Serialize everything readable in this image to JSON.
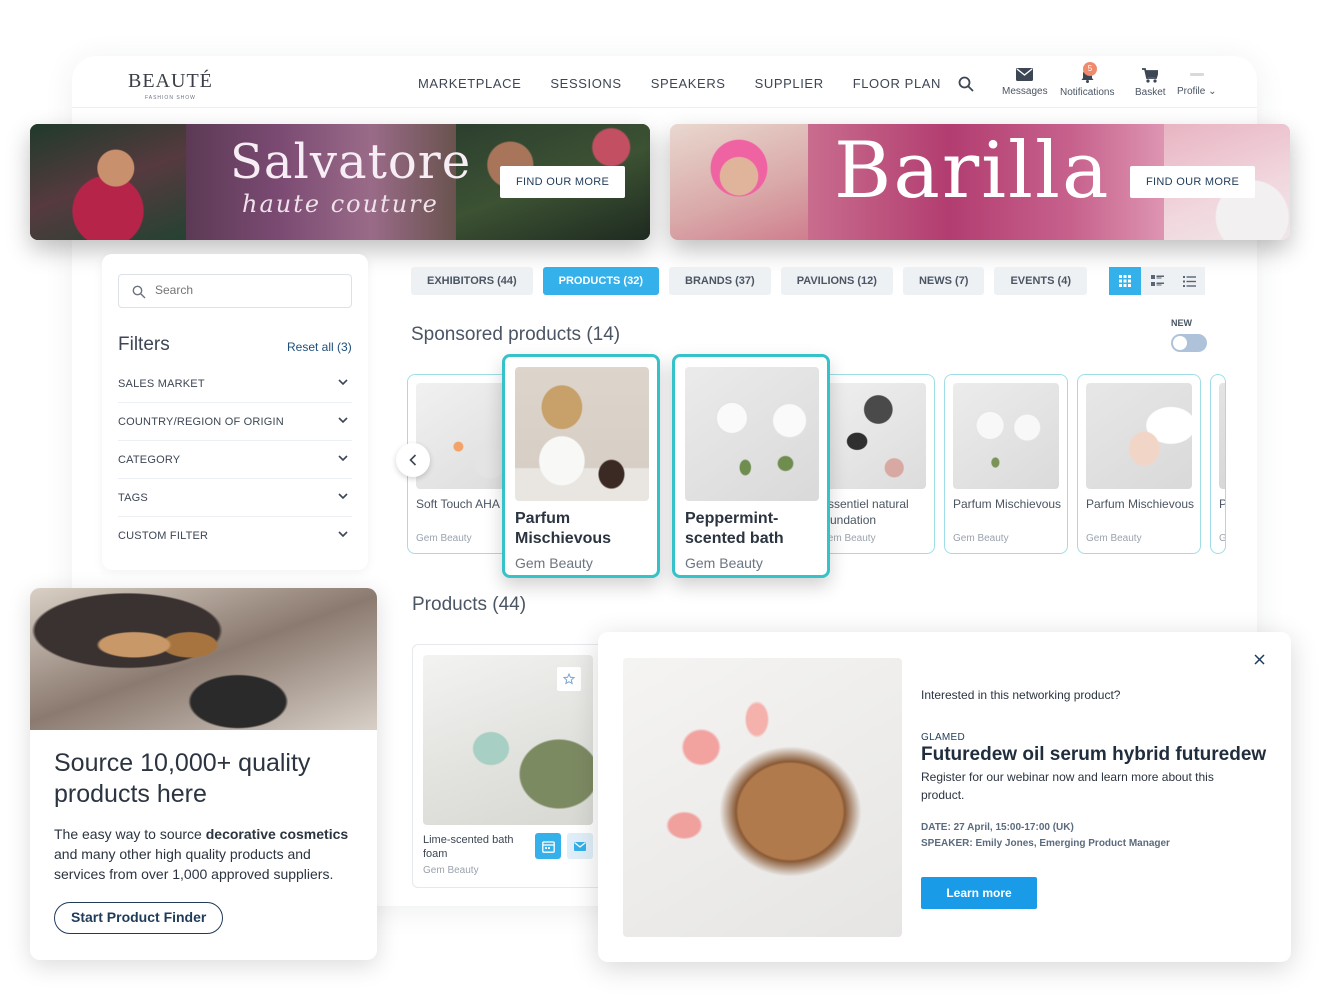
{
  "header": {
    "logo": "BEAUTÉ",
    "logo_sub": "FASHION SHOW",
    "nav": [
      "MARKETPLACE",
      "SESSIONS",
      "SPEAKERS",
      "SUPPLIER",
      "FLOOR PLAN"
    ],
    "messages": "Messages",
    "notifications": "Notifications",
    "notification_count": "5",
    "basket": "Basket",
    "profile": "Profile"
  },
  "banners": [
    {
      "brand": "Salvatore",
      "tagline": "haute couture",
      "button": "FIND OUR MORE"
    },
    {
      "brand": "Barilla",
      "button": "FIND OUR MORE"
    }
  ],
  "filters": {
    "search_placeholder": "Search",
    "title": "Filters",
    "reset": "Reset all (3)",
    "items": [
      "SALES MARKET",
      "COUNTRY/REGION OF ORIGIN",
      "CATEGORY",
      "TAGS",
      "CUSTOM FILTER"
    ]
  },
  "tabs": [
    "EXHIBITORS (44)",
    "PRODUCTS (32)",
    "BRANDS (37)",
    "PAVILIONS (12)",
    "NEWS (7)",
    "EVENTS (4)"
  ],
  "active_tab": "PRODUCTS (32)",
  "sponsored": {
    "title": "Sponsored products (14)",
    "new_label": "NEW",
    "cards": [
      {
        "title": "Soft Touch AHA",
        "brand": "Gem Beauty"
      },
      {
        "title": "Parfum Mischievous",
        "brand": "Gem Beauty"
      },
      {
        "title": "Peppermint-scented bath",
        "brand": "Gem Beauty"
      },
      {
        "title": "Essentiel natural foundation",
        "brand": "Gem Beauty"
      },
      {
        "title": "Parfum Mischievous",
        "brand": "Gem Beauty"
      },
      {
        "title": "Parfum Mischievous",
        "brand": "Gem Beauty"
      },
      {
        "title": "P M",
        "brand": "G"
      }
    ]
  },
  "products": {
    "title": "Products (44)",
    "card": {
      "title": "Lime-scented bath foam",
      "brand": "Gem Beauty"
    }
  },
  "promo": {
    "title": "Source 10,000+ quality products here",
    "body_pre": "The easy way to source ",
    "body_bold": "decorative cosmetics",
    "body_post": " and many other high quality products and services from over 1,000 approved suppliers.",
    "button": "Start Product Finder"
  },
  "modal": {
    "question": "Interested in this networking product?",
    "company": "GLAMED",
    "title": "Futuredew oil serum hybrid futuredew",
    "description": "Register for our webinar now and learn more about this product.",
    "date": "DATE: 27 April, 15:00-17:00 (UK)",
    "speaker": "SPEAKER: Emily Jones, Emerging Product Manager",
    "button": "Learn more"
  },
  "colors": {
    "accent": "#34b0ea",
    "highlight_border": "#35c2c9",
    "navy": "#1f3b5a",
    "badge": "#f08a6c"
  }
}
